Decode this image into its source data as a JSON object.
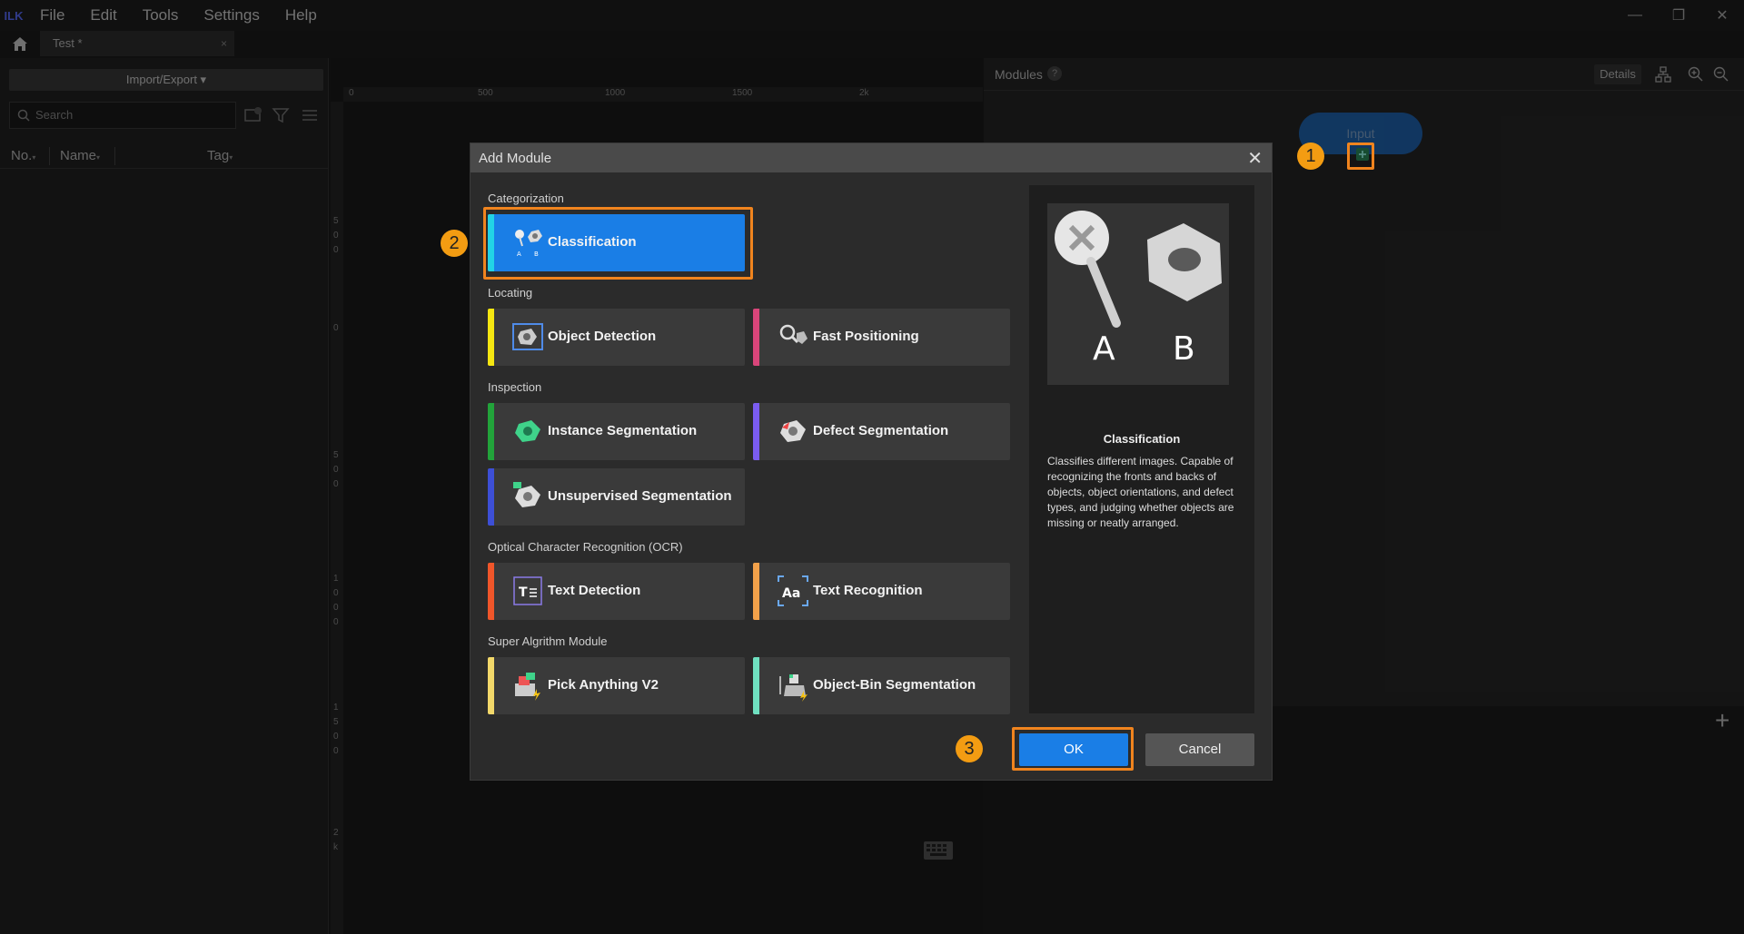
{
  "app": {
    "logo": "ILK",
    "menu": [
      "File",
      "Edit",
      "Tools",
      "Settings",
      "Help"
    ],
    "window_controls": {
      "minimize": "—",
      "restore": "❐",
      "close": "✕"
    }
  },
  "tabs": [
    {
      "label": "Test *",
      "close": "×"
    }
  ],
  "left_panel": {
    "import_export": "Import/Export ▾",
    "search_placeholder": "Search",
    "columns": [
      "No.",
      "Name",
      "Tag"
    ],
    "sort_glyph": "▾"
  },
  "ruler": {
    "top": [
      "0",
      "500",
      "1000",
      "1500",
      "2k"
    ],
    "left": [
      "5",
      "0",
      "0",
      "0",
      "5",
      "0",
      "0",
      "1",
      "0",
      "0",
      "0",
      "1",
      "5",
      "0",
      "0",
      "2",
      "k"
    ]
  },
  "modules_panel": {
    "title": "Modules",
    "help": "?",
    "details": "Details",
    "input_node": "Input",
    "add": "+"
  },
  "dialog": {
    "title": "Add Module",
    "close": "✕",
    "categories": [
      {
        "label": "Categorization",
        "modules": [
          {
            "label": "Classification",
            "stripe": "#22d3e6",
            "selected": true
          }
        ]
      },
      {
        "label": "Locating",
        "modules": [
          {
            "label": "Object Detection",
            "stripe": "#f5e611"
          },
          {
            "label": "Fast Positioning",
            "stripe": "#d9457a"
          }
        ]
      },
      {
        "label": "Inspection",
        "modules": [
          {
            "label": "Instance Segmentation",
            "stripe": "#22a33a"
          },
          {
            "label": "Defect Segmentation",
            "stripe": "#7a5cf0"
          },
          {
            "label": "Unsupervised Segmentation",
            "stripe": "#3d4fd6"
          }
        ]
      },
      {
        "label": "Optical Character Recognition (OCR)",
        "modules": [
          {
            "label": "Text Detection",
            "stripe": "#f0562a"
          },
          {
            "label": "Text Recognition",
            "stripe": "#f2a14a"
          }
        ]
      },
      {
        "label": "Super Algrithm Module",
        "modules": [
          {
            "label": "Pick Anything V2",
            "stripe": "#f2d86a"
          },
          {
            "label": "Object-Bin Segmentation",
            "stripe": "#6fe0c0"
          }
        ]
      }
    ],
    "preview": {
      "image_labels": [
        "A",
        "B"
      ],
      "name": "Classification",
      "description": "Classifies different images. Capable of recognizing the fronts and backs of objects, object orientations, and defect types, and judging whether objects are missing or neatly arranged."
    },
    "ok": "OK",
    "cancel": "Cancel"
  },
  "callouts": [
    "1",
    "2",
    "3"
  ]
}
